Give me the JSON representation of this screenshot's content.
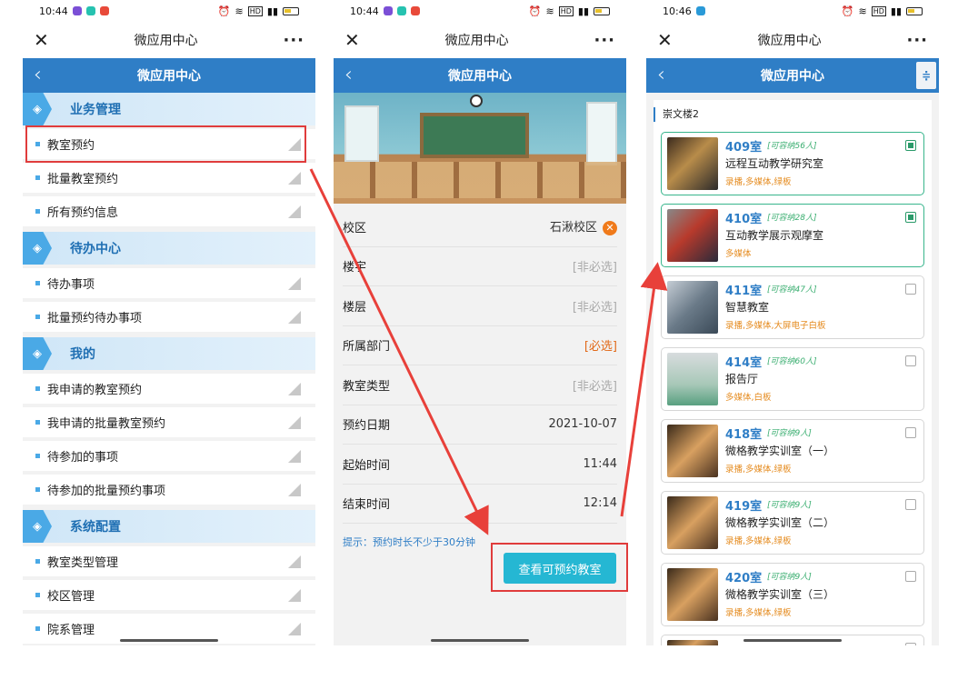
{
  "status": {
    "p1_time": "10:44",
    "p2_time": "10:44",
    "p3_time": "10:46",
    "network": "HD"
  },
  "wechat": {
    "title": "微应用中心",
    "close": "✕",
    "more": "···"
  },
  "app": {
    "title": "微应用中心",
    "back": "‹"
  },
  "panel1": {
    "sections": [
      {
        "title": "业务管理",
        "items": [
          "教室预约",
          "批量教室预约",
          "所有预约信息"
        ]
      },
      {
        "title": "待办中心",
        "items": [
          "待办事项",
          "批量预约待办事项"
        ]
      },
      {
        "title": "我的",
        "items": [
          "我申请的教室预约",
          "我申请的批量教室预约",
          "待参加的事项",
          "待参加的批量预约事项"
        ]
      },
      {
        "title": "系统配置",
        "items": [
          "教室类型管理",
          "校区管理",
          "院系管理"
        ]
      }
    ]
  },
  "panel2": {
    "rows": [
      {
        "label": "校区",
        "value": "石湫校区"
      },
      {
        "label": "楼宇",
        "value": "[非必选]"
      },
      {
        "label": "楼层",
        "value": "[非必选]"
      },
      {
        "label": "所属部门",
        "value": "[必选]"
      },
      {
        "label": "教室类型",
        "value": "[非必选]"
      },
      {
        "label": "预约日期",
        "value": "2021-10-07"
      },
      {
        "label": "起始时间",
        "value": "11:44"
      },
      {
        "label": "结束时间",
        "value": "12:14"
      }
    ],
    "hint": "提示：预约时长不少于30分钟",
    "cta": "查看可预约教室"
  },
  "panel3": {
    "building": "崇文楼2",
    "rooms": [
      {
        "no": "409室",
        "cap": "[可容纳56人]",
        "name": "远程互动教学研究室",
        "fac": "录播,多媒体,绿板",
        "checked": true
      },
      {
        "no": "410室",
        "cap": "[可容纳28人]",
        "name": "互动教学展示观摩室",
        "fac": "多媒体",
        "checked": true
      },
      {
        "no": "411室",
        "cap": "[可容纳47人]",
        "name": "智慧教室",
        "fac": "录播,多媒体,大屏电子白板",
        "checked": false
      },
      {
        "no": "414室",
        "cap": "[可容纳60人]",
        "name": "报告厅",
        "fac": "多媒体,白板",
        "checked": false
      },
      {
        "no": "418室",
        "cap": "[可容纳9人]",
        "name": "微格教学实训室（一）",
        "fac": "录播,多媒体,绿板",
        "checked": false
      },
      {
        "no": "419室",
        "cap": "[可容纳9人]",
        "name": "微格教学实训室（二）",
        "fac": "录播,多媒体,绿板",
        "checked": false
      },
      {
        "no": "420室",
        "cap": "[可容纳9人]",
        "name": "微格教学实训室（三）",
        "fac": "录播,多媒体,绿板",
        "checked": false
      }
    ]
  },
  "colors": {
    "accent_blue": "#2f7ec6",
    "highlight_red": "#e03c3c",
    "cta_teal": "#25b7d3"
  }
}
